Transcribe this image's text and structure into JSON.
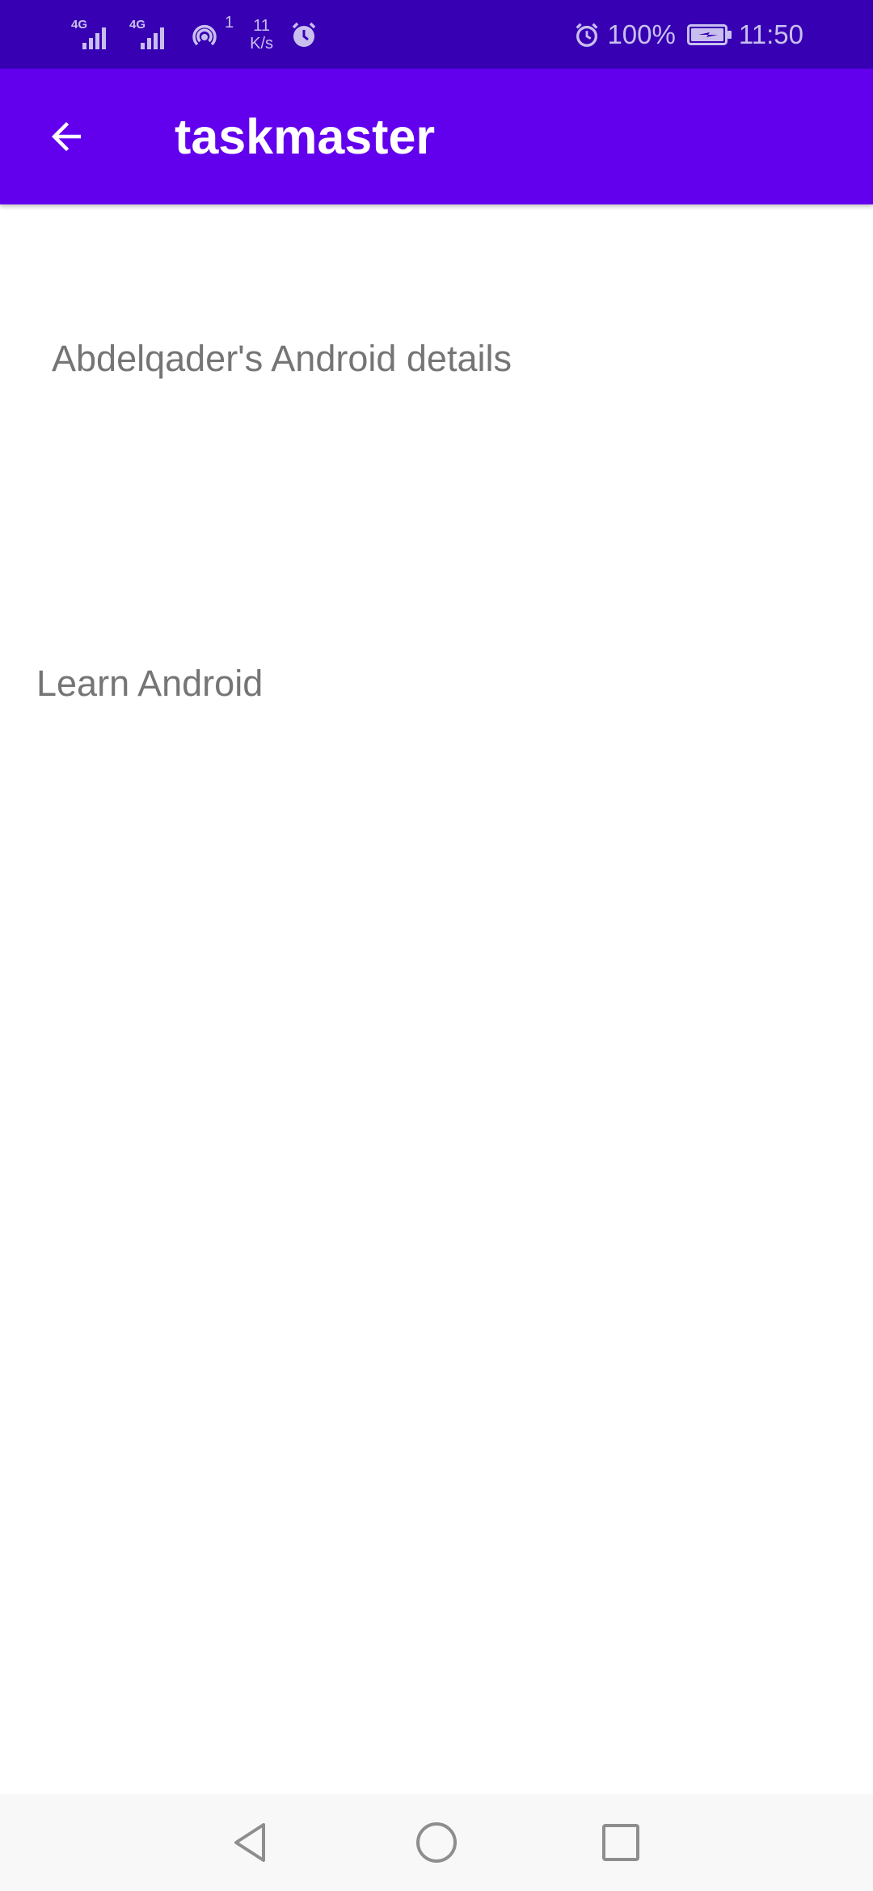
{
  "status_bar": {
    "net_type_1": "4G",
    "net_type_2": "4G",
    "hotspot_count": "1",
    "speed_value": "11",
    "speed_unit": "K/s",
    "battery_percent": "100%",
    "time": "11:50",
    "icons": [
      "signal-icon",
      "signal-icon",
      "hotspot-icon",
      "alarm-icon",
      "alarm-icon",
      "battery-charging-icon"
    ]
  },
  "app_bar": {
    "title": "taskmaster",
    "back_icon": "arrow-back-icon"
  },
  "content": {
    "details_title": "Abdelqader's Android details",
    "task_name": "Learn Android"
  },
  "nav_bar": {
    "icons": [
      "back-triangle-icon",
      "home-circle-icon",
      "recents-square-icon"
    ]
  },
  "colors": {
    "status_bar": "#3700B3",
    "app_bar": "#6200EE",
    "text_secondary": "#757575",
    "nav_bar": "#F8F8F8"
  }
}
